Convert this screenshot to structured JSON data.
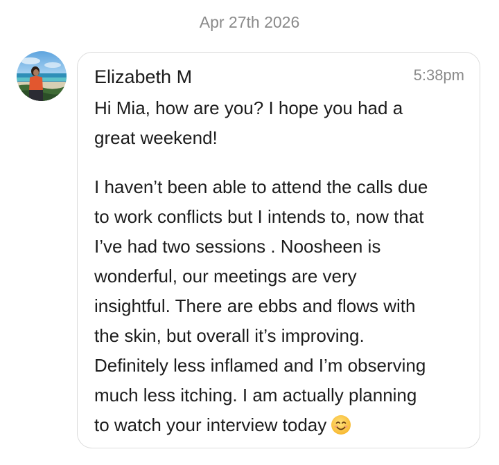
{
  "date_separator": "Apr 27th 2026",
  "message": {
    "sender": "Elizabeth M",
    "time": "5:38pm",
    "paragraph1": [
      "Hi Mia, how are you? I hope you had a",
      "great weekend!"
    ],
    "paragraph2": [
      "I haven’t been able to attend the calls due",
      "to work conflicts but I intends to, now that",
      "I’ve had two sessions . Noosheen is",
      "wonderful, our meetings are very",
      "insightful. There are ebbs and flows with",
      "the skin, but overall it’s improving.",
      "Definitely less inflamed and I’m observing",
      "much less itching. I am actually planning",
      "to watch your interview today"
    ],
    "trailing_emoji": "smiling-face-emoji"
  },
  "avatar": {
    "icon": "user-avatar-beach-photo"
  },
  "colors": {
    "text_primary": "#1c1c1c",
    "text_muted": "#8a8a8a",
    "bubble_border": "#dcdcdc",
    "background": "#ffffff"
  }
}
